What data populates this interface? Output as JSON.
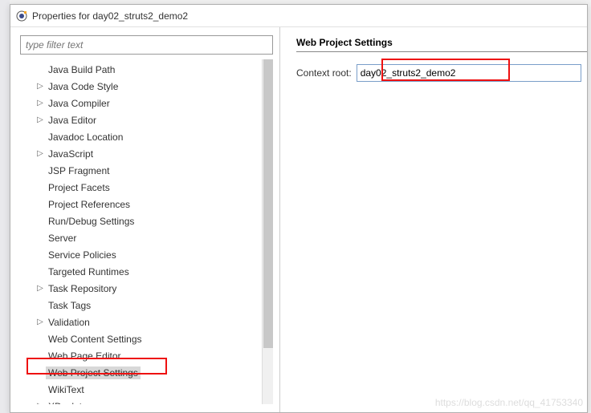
{
  "window": {
    "title": "Properties for day02_struts2_demo2"
  },
  "filter": {
    "placeholder": "type filter text"
  },
  "tree": {
    "items": [
      {
        "label": "Java Build Path",
        "expandable": false
      },
      {
        "label": "Java Code Style",
        "expandable": true
      },
      {
        "label": "Java Compiler",
        "expandable": true
      },
      {
        "label": "Java Editor",
        "expandable": true
      },
      {
        "label": "Javadoc Location",
        "expandable": false
      },
      {
        "label": "JavaScript",
        "expandable": true
      },
      {
        "label": "JSP Fragment",
        "expandable": false
      },
      {
        "label": "Project Facets",
        "expandable": false
      },
      {
        "label": "Project References",
        "expandable": false
      },
      {
        "label": "Run/Debug Settings",
        "expandable": false
      },
      {
        "label": "Server",
        "expandable": false
      },
      {
        "label": "Service Policies",
        "expandable": false
      },
      {
        "label": "Targeted Runtimes",
        "expandable": false
      },
      {
        "label": "Task Repository",
        "expandable": true
      },
      {
        "label": "Task Tags",
        "expandable": false
      },
      {
        "label": "Validation",
        "expandable": true
      },
      {
        "label": "Web Content Settings",
        "expandable": false
      },
      {
        "label": "Web Page Editor",
        "expandable": false
      },
      {
        "label": "Web Project Settings",
        "expandable": false,
        "selected": true
      },
      {
        "label": "WikiText",
        "expandable": false
      },
      {
        "label": "XDoclet",
        "expandable": true
      }
    ]
  },
  "right": {
    "header": "Web Project Settings",
    "context_root_label": "Context root:",
    "context_root_value": "day02_struts2_demo2"
  },
  "watermark": "https://blog.csdn.net/qq_41753340"
}
